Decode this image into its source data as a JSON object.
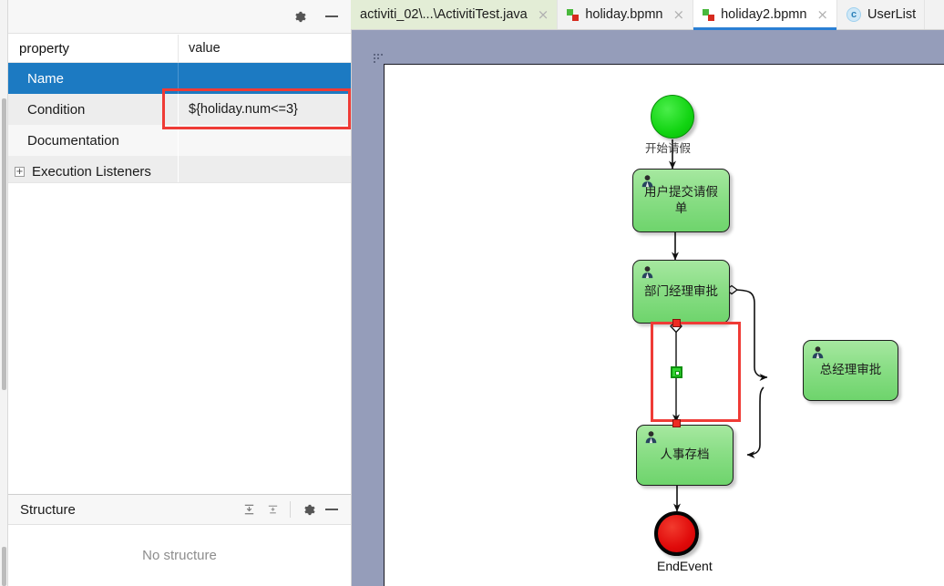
{
  "properties_panel": {
    "toolbar": {
      "gear_icon": "gear-icon",
      "minimize_icon": "minimize-icon"
    },
    "columns": {
      "property": "property",
      "value": "value"
    },
    "rows": [
      {
        "name": "Name",
        "value": "",
        "selected": true,
        "expandable": false
      },
      {
        "name": "Condition",
        "value": "${holiday.num<=3}",
        "selected": false,
        "expandable": false
      },
      {
        "name": "Documentation",
        "value": "",
        "selected": false,
        "expandable": false
      },
      {
        "name": "Execution Listeners",
        "value": "",
        "selected": false,
        "expandable": true,
        "expander": "+"
      }
    ],
    "highlight_color": "#ef3b36",
    "selection_color": "#1c7ac2"
  },
  "structure_panel": {
    "title": "Structure",
    "empty_text": "No structure",
    "icons": [
      "collapse-all-icon",
      "expand-all-icon",
      "gear-icon",
      "minimize-icon"
    ]
  },
  "tabs": [
    {
      "label": "activiti_02\\...\\ActivitiTest.java",
      "icon": "",
      "style": "green",
      "active": false,
      "close": "×"
    },
    {
      "label": "holiday.bpmn",
      "icon": "bpmn-file-icon",
      "style": "plain",
      "active": false,
      "close": "×"
    },
    {
      "label": "holiday2.bpmn",
      "icon": "bpmn-file-icon",
      "style": "active",
      "active": true,
      "close": "×"
    },
    {
      "label": "UserList",
      "icon": "java-class-icon",
      "style": "plain",
      "active": false,
      "close": ""
    }
  ],
  "diagram": {
    "type": "bpmn-process",
    "canvas_background": "#ffffff",
    "editor_background": "#959dba",
    "nodes": [
      {
        "id": "start",
        "kind": "start-event",
        "label": "",
        "shape": "circle"
      },
      {
        "id": "task1",
        "kind": "user-task",
        "label": "用户提交请假单",
        "shape": "rounded-rect"
      },
      {
        "id": "task2",
        "kind": "user-task",
        "label": "部门经理审批",
        "shape": "rounded-rect"
      },
      {
        "id": "task3",
        "kind": "user-task",
        "label": "总经理审批",
        "shape": "rounded-rect"
      },
      {
        "id": "task4",
        "kind": "user-task",
        "label": "人事存档",
        "shape": "rounded-rect"
      },
      {
        "id": "end",
        "kind": "end-event",
        "label": "EndEvent",
        "shape": "circle"
      }
    ],
    "edge_labels": [
      {
        "id": "flow-start",
        "text": "开始请假"
      }
    ],
    "selected_edge": {
      "from": "task2",
      "to": "task4",
      "conditional": true,
      "selection_color": "#ef3b36",
      "midpoint_handle": "green-square-handle"
    }
  }
}
